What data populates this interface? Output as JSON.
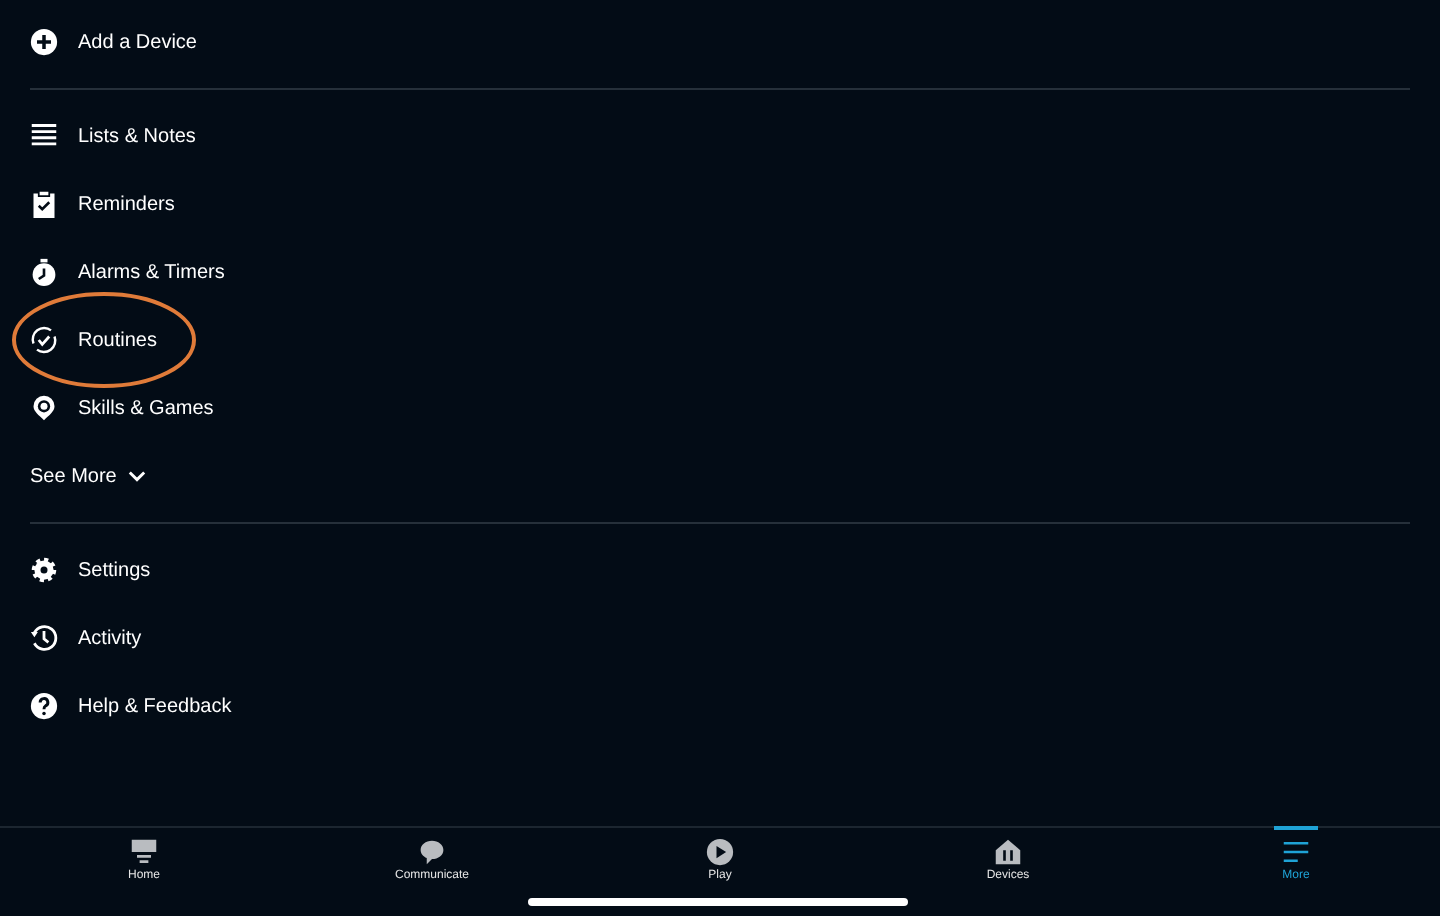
{
  "groups": [
    {
      "items": [
        {
          "kind": "plus",
          "label": "Add a Device",
          "highlighted": false
        }
      ]
    },
    {
      "items": [
        {
          "kind": "list",
          "label": "Lists & Notes",
          "highlighted": false
        },
        {
          "kind": "clipboard",
          "label": "Reminders",
          "highlighted": false
        },
        {
          "kind": "alarm",
          "label": "Alarms & Timers",
          "highlighted": false
        },
        {
          "kind": "routine",
          "label": "Routines",
          "highlighted": true
        },
        {
          "kind": "skills",
          "label": "Skills & Games",
          "highlighted": false
        }
      ],
      "see_more": "See More"
    },
    {
      "items": [
        {
          "kind": "gear",
          "label": "Settings",
          "highlighted": false
        },
        {
          "kind": "history",
          "label": "Activity",
          "highlighted": false
        },
        {
          "kind": "help",
          "label": "Help & Feedback",
          "highlighted": false
        }
      ]
    }
  ],
  "tabs": [
    {
      "kind": "home",
      "label": "Home",
      "selected": false
    },
    {
      "kind": "chat",
      "label": "Communicate",
      "selected": false
    },
    {
      "kind": "play",
      "label": "Play",
      "selected": false
    },
    {
      "kind": "devices",
      "label": "Devices",
      "selected": false
    },
    {
      "kind": "more",
      "label": "More",
      "selected": true
    }
  ]
}
